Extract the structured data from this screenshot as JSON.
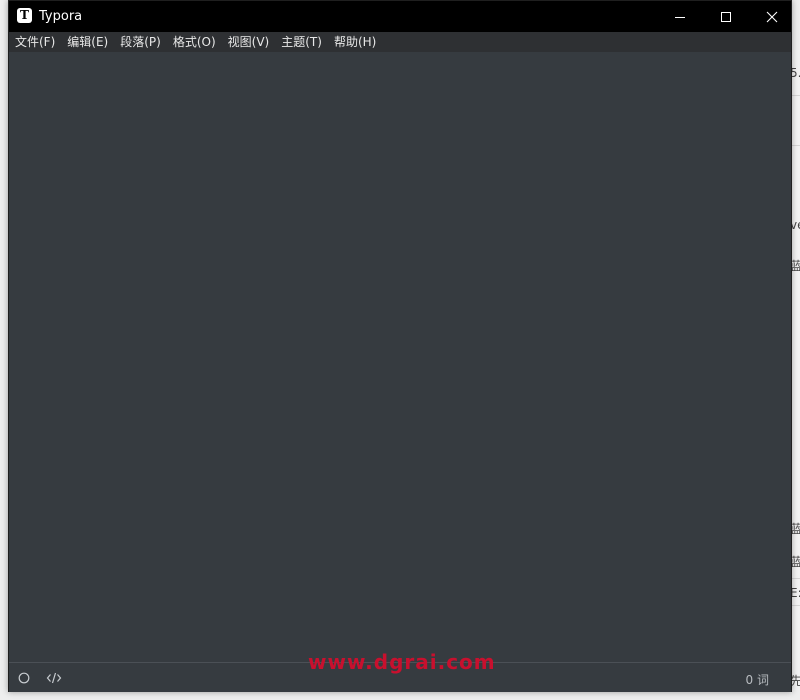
{
  "window": {
    "title": "Typora",
    "app_icon_letter": "T"
  },
  "menu": {
    "items": [
      {
        "label": "文件(F)"
      },
      {
        "label": "编辑(E)"
      },
      {
        "label": "段落(P)"
      },
      {
        "label": "格式(O)"
      },
      {
        "label": "视图(V)"
      },
      {
        "label": "主题(T)"
      },
      {
        "label": "帮助(H)"
      }
    ]
  },
  "editor": {
    "content": ""
  },
  "statusbar": {
    "word_count": "0 词"
  },
  "background_window": {
    "fragments": [
      "5.",
      "ve",
      "蓝",
      "蓝",
      "蓝",
      "E:",
      "先"
    ]
  },
  "watermark": "www.dgrai.com",
  "colors": {
    "titlebar": "#000000",
    "menubar": "#2e3033",
    "editor_bg": "#363b40",
    "watermark": "#c8102e"
  }
}
